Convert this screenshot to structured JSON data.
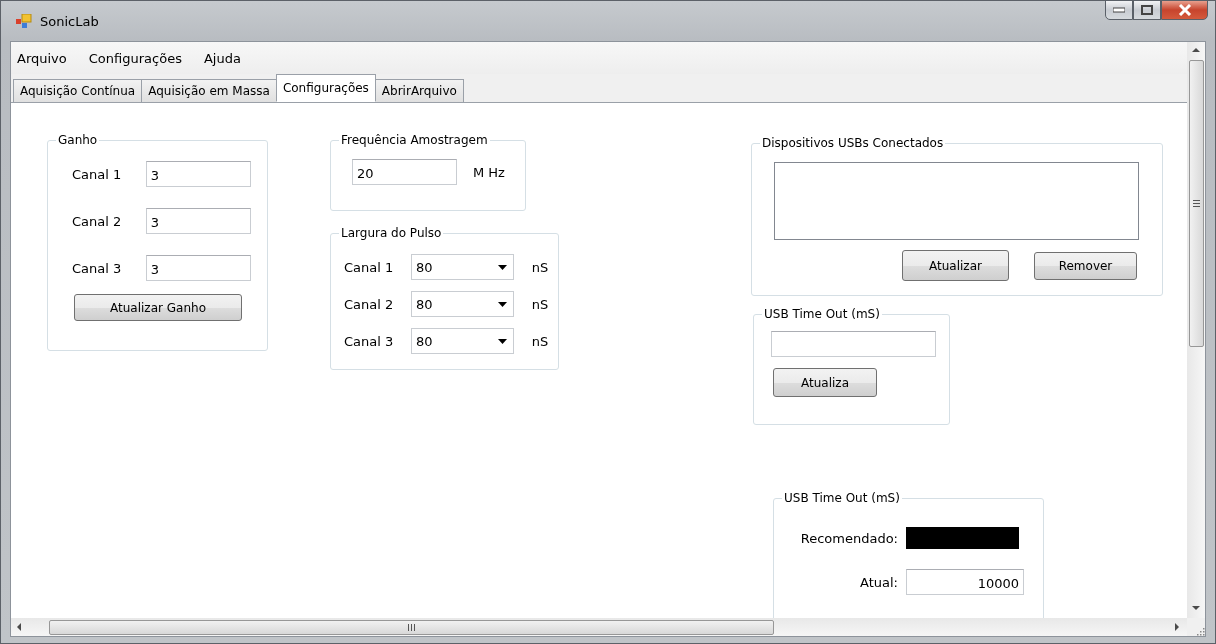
{
  "window": {
    "title": "SonicLab"
  },
  "menu": [
    {
      "label": "Arquivo"
    },
    {
      "label": "Configurações"
    },
    {
      "label": "Ajuda"
    }
  ],
  "tabs": [
    {
      "label": "Aquisição Contínua",
      "selected": false
    },
    {
      "label": "Aquisição em Massa",
      "selected": false
    },
    {
      "label": "Configurações",
      "selected": true
    },
    {
      "label": "AbrirArquivo",
      "selected": false
    }
  ],
  "gain": {
    "title": "Ganho",
    "channels": [
      {
        "label": "Canal 1",
        "value": "3"
      },
      {
        "label": "Canal 2",
        "value": "3"
      },
      {
        "label": "Canal 3",
        "value": "3"
      }
    ],
    "button": "Atualizar Ganho"
  },
  "sampling": {
    "title": "Frequência Amostragem",
    "value": "20",
    "unit": "M Hz"
  },
  "pulse_width": {
    "title": "Largura do Pulso",
    "channels": [
      {
        "label": "Canal 1",
        "value": "80",
        "unit": "nS"
      },
      {
        "label": "Canal 2",
        "value": "80",
        "unit": "nS"
      },
      {
        "label": "Canal 3",
        "value": "80",
        "unit": "nS"
      }
    ]
  },
  "usb_devices": {
    "title": "Dispositivos USBs Conectados",
    "buttons": [
      "Atualizar",
      "Remover"
    ]
  },
  "usb_timeout": {
    "title": "USB Time Out (mS)",
    "button": "Atualiza"
  },
  "usb_timeout_status": {
    "title": "USB Time Out (mS)",
    "recommended_label": "Recomendado:",
    "current_label": "Atual:",
    "current_value": "10000"
  }
}
